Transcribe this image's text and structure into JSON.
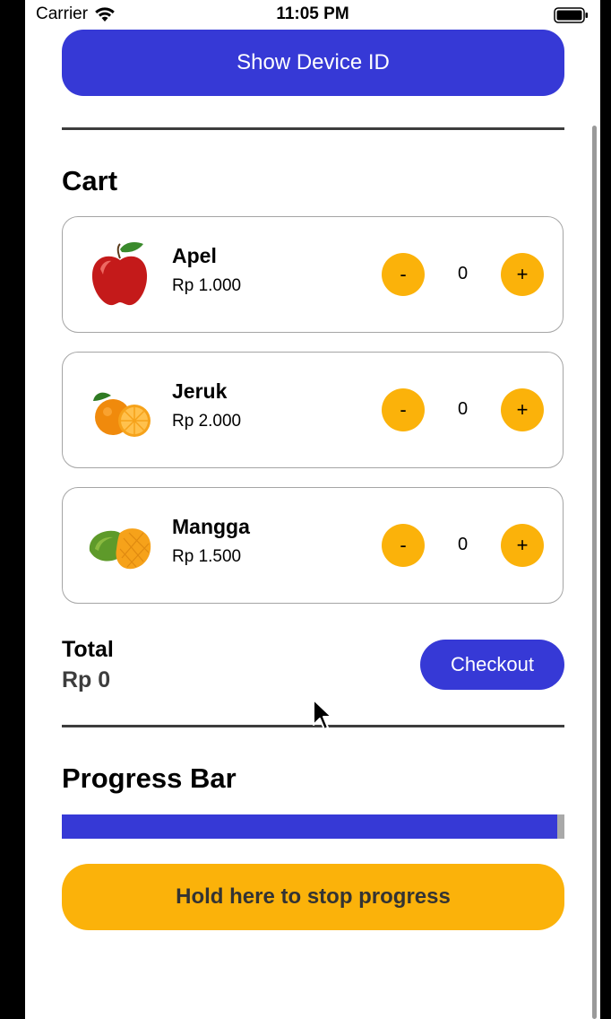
{
  "status_bar": {
    "carrier": "Carrier",
    "time": "11:05 PM"
  },
  "device_button": {
    "label": "Show Device ID"
  },
  "cart": {
    "title": "Cart",
    "items": [
      {
        "name": "Apel",
        "price": "Rp 1.000",
        "quantity": "0",
        "minus_label": "-",
        "plus_label": "+",
        "icon": "apple-icon"
      },
      {
        "name": "Jeruk",
        "price": "Rp 2.000",
        "quantity": "0",
        "minus_label": "-",
        "plus_label": "+",
        "icon": "orange-icon"
      },
      {
        "name": "Mangga",
        "price": "Rp 1.500",
        "quantity": "0",
        "minus_label": "-",
        "plus_label": "+",
        "icon": "mango-icon"
      }
    ],
    "total_label": "Total",
    "total_value": "Rp 0",
    "checkout_label": "Checkout"
  },
  "progress": {
    "title": "Progress Bar",
    "value_percent": 98.5,
    "hold_label": "Hold here to stop progress"
  },
  "colors": {
    "primary": "#3639d6",
    "accent": "#fbb20a",
    "track": "#a9a9a9"
  }
}
